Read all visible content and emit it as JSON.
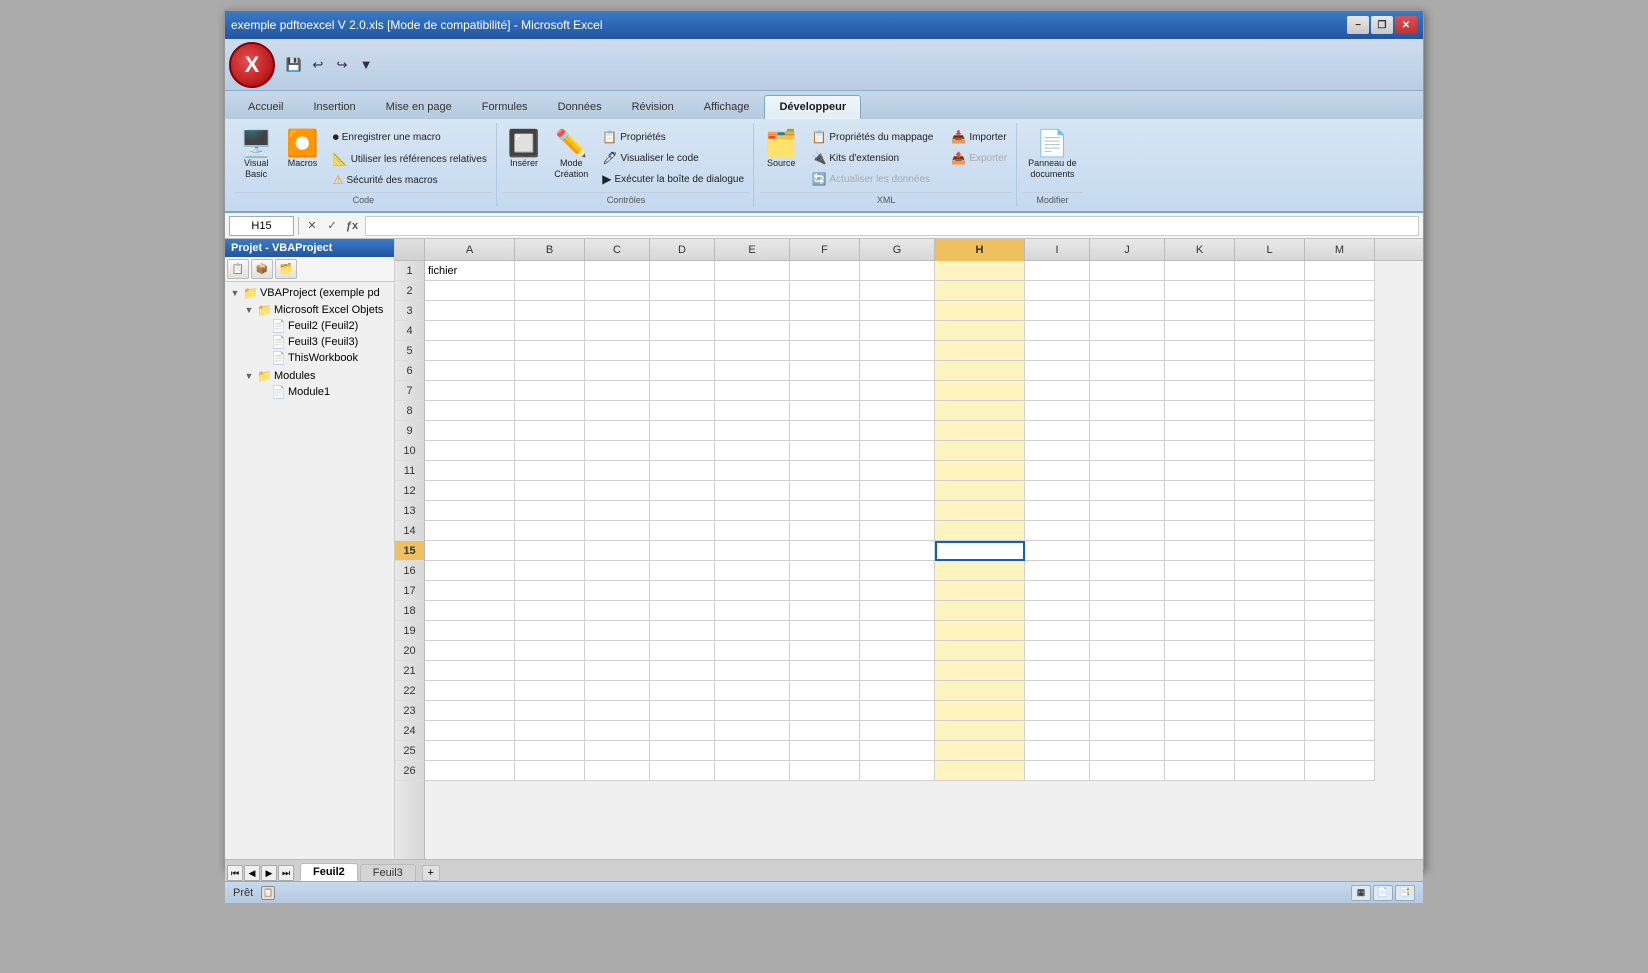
{
  "window": {
    "title": "exemple pdftoexcel V 2.0.xls [Mode de compatibilité] - Microsoft Excel",
    "minimize_label": "−",
    "restore_label": "❐",
    "close_label": "✕"
  },
  "quickaccess": {
    "save_label": "💾",
    "undo_label": "↩",
    "redo_label": "↪",
    "dropdown_label": "▼"
  },
  "ribbon": {
    "tabs": [
      {
        "label": "Accueil",
        "active": false
      },
      {
        "label": "Insertion",
        "active": false
      },
      {
        "label": "Mise en page",
        "active": false
      },
      {
        "label": "Formules",
        "active": false
      },
      {
        "label": "Données",
        "active": false
      },
      {
        "label": "Révision",
        "active": false
      },
      {
        "label": "Affichage",
        "active": false
      },
      {
        "label": "Développeur",
        "active": true
      }
    ],
    "groups": {
      "code": {
        "label": "Code",
        "visual_basic_label": "Visual\nBasic",
        "macros_label": "Macros",
        "enregistrer_macro": "Enregistrer une macro",
        "utiliser_references": "Utiliser les références relatives",
        "securite_macros": "Sécurité des macros"
      },
      "controles": {
        "label": "Contrôles",
        "inserer_label": "Insérer",
        "mode_creation_label": "Mode\nCréation",
        "proprietes_label": "Propriétés",
        "visualiser_code_label": "Visualiser le code",
        "executer_boite_label": "Exécuter la boîte de dialogue"
      },
      "xml": {
        "label": "XML",
        "source_label": "Source",
        "proprietes_mappage_label": "Propriétés du mappage",
        "kits_extension_label": "Kits d'extension",
        "actualiser_donnees_label": "Actualiser les données",
        "importer_label": "Importer",
        "exporter_label": "Exporter"
      },
      "modifier": {
        "label": "Modifier",
        "panneau_documents_label": "Panneau de\ndocuments"
      }
    }
  },
  "formula_bar": {
    "cell_ref": "H15",
    "formula_content": ""
  },
  "sidebar": {
    "title": "Projet - VBAProject",
    "tree": [
      {
        "label": "VBAProject (exemple pd",
        "icon": "📁",
        "expanded": true,
        "children": [
          {
            "label": "Microsoft Excel Objets",
            "icon": "📁",
            "expanded": true,
            "children": [
              {
                "label": "Feuil2 (Feuil2)",
                "icon": "📄"
              },
              {
                "label": "Feuil3 (Feuil3)",
                "icon": "📄"
              },
              {
                "label": "ThisWorkbook",
                "icon": "📄"
              }
            ]
          },
          {
            "label": "Modules",
            "icon": "📁",
            "expanded": true,
            "children": [
              {
                "label": "Module1",
                "icon": "📄"
              }
            ]
          }
        ]
      }
    ]
  },
  "spreadsheet": {
    "columns": [
      "A",
      "B",
      "C",
      "D",
      "E",
      "F",
      "G",
      "H",
      "I",
      "J",
      "K",
      "L",
      "M"
    ],
    "active_col": "H",
    "active_row": 15,
    "rows": 26,
    "cell_a1": "fichier",
    "selected_cell": "H15"
  },
  "sheet_tabs": [
    {
      "label": "Feuil2",
      "active": true
    },
    {
      "label": "Feuil3",
      "active": false
    }
  ],
  "status_bar": {
    "text": "Prêt"
  }
}
